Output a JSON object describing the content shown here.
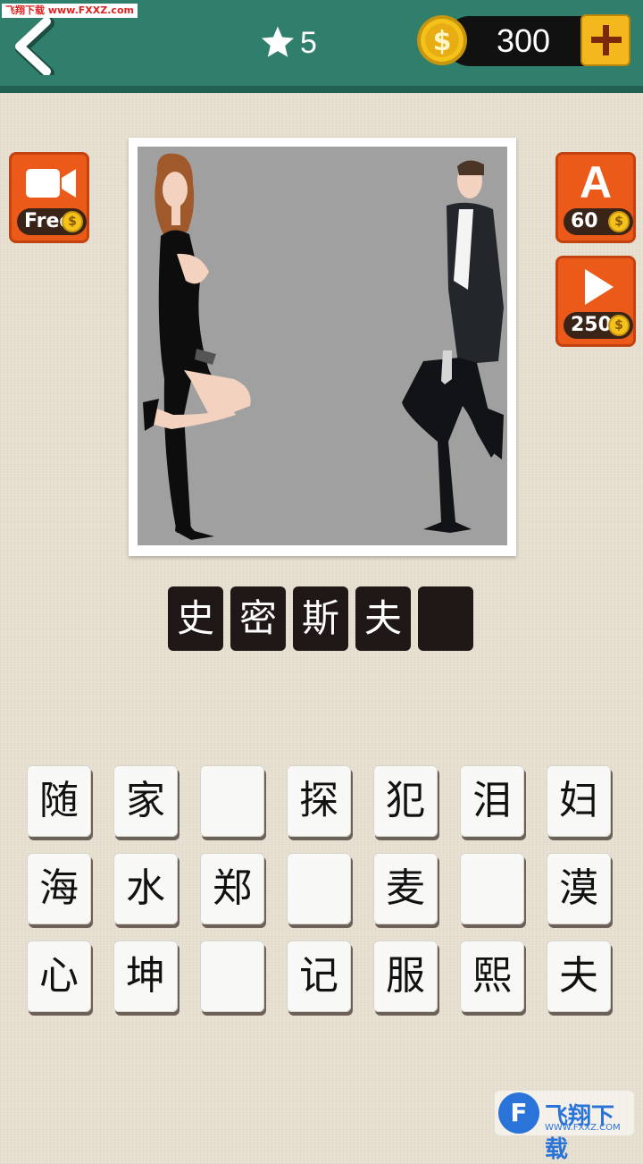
{
  "header": {
    "watermark": "飞翔下载 www.FXXZ.com",
    "level": "5",
    "coins": "300",
    "coin_symbol": "$"
  },
  "side_buttons": {
    "video": {
      "label": "Free",
      "icon": "video-camera-icon"
    },
    "reveal_letter": {
      "icon_letter": "A",
      "cost": "60"
    },
    "skip": {
      "icon": "play-icon",
      "cost": "250"
    }
  },
  "puzzle": {
    "image_description_icon": "couple-with-gun-illustration",
    "answer_slots": [
      "史",
      "密",
      "斯",
      "夫",
      ""
    ]
  },
  "keyboard": {
    "rows": [
      [
        "随",
        "家",
        "",
        "探",
        "犯",
        "泪",
        "妇"
      ],
      [
        "海",
        "水",
        "郑",
        "",
        "麦",
        "",
        "漠"
      ],
      [
        "心",
        "坤",
        "",
        "记",
        "服",
        "熙",
        "夫"
      ]
    ]
  },
  "watermark_bottom": {
    "title": "飞翔下载",
    "url": "WWW.FXXZ.COM"
  },
  "colors": {
    "header": "#2f7f6c",
    "accent_orange": "#ec5a1a",
    "coin_gold": "#f5c21c",
    "slot_dark": "#201817",
    "background": "#e6dfd0"
  }
}
